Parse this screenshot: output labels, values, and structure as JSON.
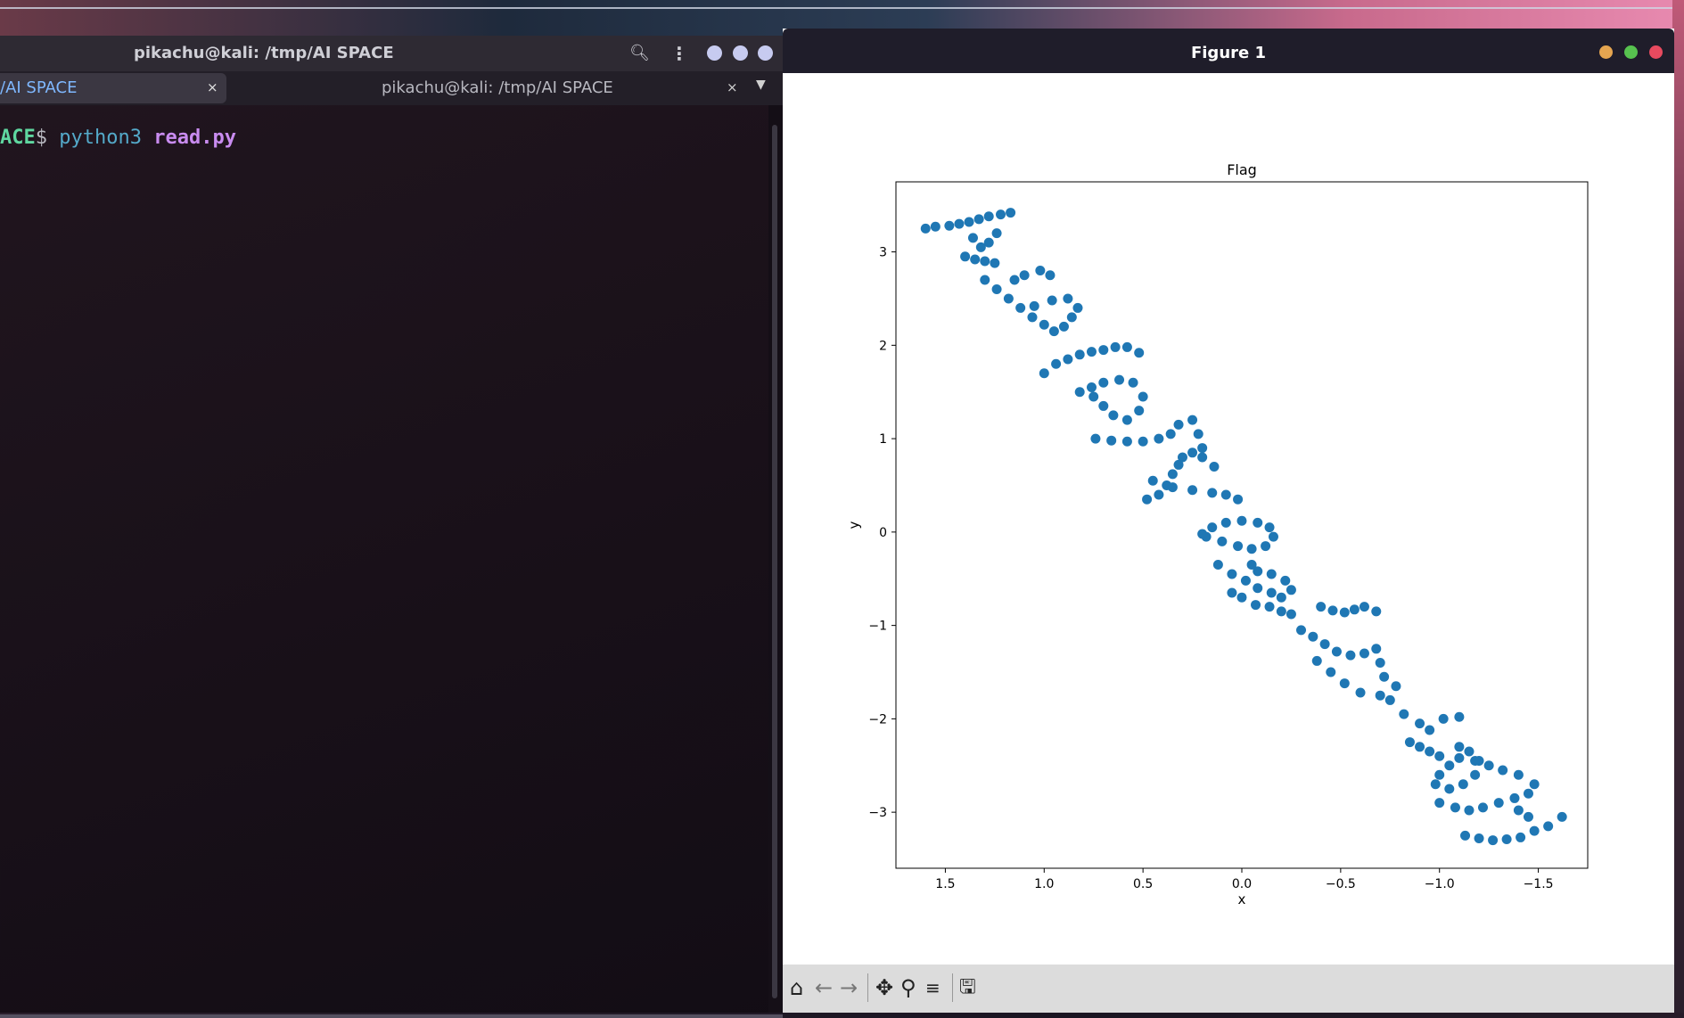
{
  "terminal": {
    "window_title": "pikachu@kali: /tmp/AI SPACE",
    "tabs": [
      {
        "label": "/AI SPACE",
        "close": "×"
      },
      {
        "label": "pikachu@kali: /tmp/AI SPACE",
        "close": "×"
      }
    ],
    "prompt": {
      "dir": "ACE",
      "dollar": "$ ",
      "command": "python3 ",
      "argument": "read.py"
    },
    "dot_color": "#c7cbf0"
  },
  "figure": {
    "window_title": "Figure 1",
    "dot_colors": [
      "#e5a550",
      "#57c24f",
      "#e84a5f"
    ],
    "toolbar": [
      "home-icon",
      "back-icon",
      "forward-icon",
      "pan-icon",
      "zoom-icon",
      "configure-icon",
      "save-icon"
    ]
  },
  "chart_data": {
    "type": "scatter",
    "title": "Flag",
    "xlabel": "x",
    "ylabel": "y",
    "xlim": [
      1.75,
      -1.75
    ],
    "ylim": [
      3.75,
      -3.6
    ],
    "xticks": [
      1.5,
      1.0,
      0.5,
      0.0,
      -0.5,
      -1.0,
      -1.5
    ],
    "xtick_labels": [
      "1.5",
      "1.0",
      "0.5",
      "0.0",
      "−0.5",
      "−1.0",
      "−1.5"
    ],
    "yticks": [
      -3,
      -2,
      -1,
      0,
      1,
      2,
      3
    ],
    "ytick_labels": [
      "−3",
      "−2",
      "−1",
      "0",
      "1",
      "2",
      "3"
    ],
    "color": "#1f77b4",
    "grid": false,
    "series": [
      {
        "values": [
          [
            1.6,
            3.25
          ],
          [
            1.55,
            3.27
          ],
          [
            1.48,
            3.28
          ],
          [
            1.43,
            3.3
          ],
          [
            1.38,
            3.32
          ],
          [
            1.33,
            3.35
          ],
          [
            1.28,
            3.38
          ],
          [
            1.22,
            3.4
          ],
          [
            1.17,
            3.42
          ],
          [
            1.4,
            2.95
          ],
          [
            1.35,
            2.92
          ],
          [
            1.3,
            2.9
          ],
          [
            1.25,
            2.88
          ],
          [
            1.32,
            3.05
          ],
          [
            1.36,
            3.15
          ],
          [
            1.28,
            3.1
          ],
          [
            1.24,
            3.2
          ],
          [
            1.3,
            2.7
          ],
          [
            1.24,
            2.6
          ],
          [
            1.18,
            2.5
          ],
          [
            1.12,
            2.4
          ],
          [
            1.06,
            2.3
          ],
          [
            1.0,
            2.22
          ],
          [
            0.95,
            2.15
          ],
          [
            0.9,
            2.2
          ],
          [
            0.86,
            2.3
          ],
          [
            0.83,
            2.4
          ],
          [
            0.88,
            2.5
          ],
          [
            0.96,
            2.48
          ],
          [
            1.05,
            2.42
          ],
          [
            1.15,
            2.7
          ],
          [
            1.1,
            2.75
          ],
          [
            1.02,
            2.8
          ],
          [
            0.97,
            2.75
          ],
          [
            1.0,
            1.7
          ],
          [
            0.94,
            1.8
          ],
          [
            0.88,
            1.85
          ],
          [
            0.82,
            1.9
          ],
          [
            0.76,
            1.93
          ],
          [
            0.7,
            1.95
          ],
          [
            0.64,
            1.98
          ],
          [
            0.58,
            1.98
          ],
          [
            0.52,
            1.92
          ],
          [
            0.82,
            1.5
          ],
          [
            0.75,
            1.45
          ],
          [
            0.7,
            1.35
          ],
          [
            0.65,
            1.25
          ],
          [
            0.58,
            1.2
          ],
          [
            0.52,
            1.3
          ],
          [
            0.5,
            1.45
          ],
          [
            0.55,
            1.6
          ],
          [
            0.62,
            1.63
          ],
          [
            0.7,
            1.6
          ],
          [
            0.76,
            1.55
          ],
          [
            0.74,
            1.0
          ],
          [
            0.66,
            0.98
          ],
          [
            0.58,
            0.97
          ],
          [
            0.5,
            0.97
          ],
          [
            0.42,
            1.0
          ],
          [
            0.36,
            1.05
          ],
          [
            0.32,
            1.15
          ],
          [
            0.25,
            1.2
          ],
          [
            0.22,
            1.05
          ],
          [
            0.2,
            0.9
          ],
          [
            0.48,
            0.35
          ],
          [
            0.42,
            0.4
          ],
          [
            0.38,
            0.5
          ],
          [
            0.35,
            0.62
          ],
          [
            0.32,
            0.72
          ],
          [
            0.3,
            0.8
          ],
          [
            0.25,
            0.85
          ],
          [
            0.2,
            0.8
          ],
          [
            0.14,
            0.7
          ],
          [
            0.45,
            0.55
          ],
          [
            0.35,
            0.48
          ],
          [
            0.25,
            0.45
          ],
          [
            0.15,
            0.42
          ],
          [
            0.08,
            0.4
          ],
          [
            0.02,
            0.35
          ],
          [
            0.18,
            -0.05
          ],
          [
            0.1,
            -0.1
          ],
          [
            0.02,
            -0.15
          ],
          [
            -0.05,
            -0.18
          ],
          [
            -0.12,
            -0.15
          ],
          [
            -0.16,
            -0.05
          ],
          [
            -0.14,
            0.05
          ],
          [
            -0.08,
            0.1
          ],
          [
            0.0,
            0.12
          ],
          [
            0.08,
            0.1
          ],
          [
            0.15,
            0.05
          ],
          [
            0.2,
            -0.02
          ],
          [
            0.12,
            -0.35
          ],
          [
            0.05,
            -0.45
          ],
          [
            -0.02,
            -0.52
          ],
          [
            -0.08,
            -0.6
          ],
          [
            -0.15,
            -0.65
          ],
          [
            -0.2,
            -0.7
          ],
          [
            -0.25,
            -0.62
          ],
          [
            -0.22,
            -0.52
          ],
          [
            -0.15,
            -0.45
          ],
          [
            -0.08,
            -0.42
          ],
          [
            -0.05,
            -0.35
          ],
          [
            -0.3,
            -1.05
          ],
          [
            -0.36,
            -1.12
          ],
          [
            -0.42,
            -1.2
          ],
          [
            -0.48,
            -1.28
          ],
          [
            -0.55,
            -1.32
          ],
          [
            -0.62,
            -1.3
          ],
          [
            -0.68,
            -1.25
          ],
          [
            -0.7,
            -1.4
          ],
          [
            -0.72,
            -1.55
          ],
          [
            -0.78,
            -1.65
          ],
          [
            -0.7,
            -1.75
          ],
          [
            -0.6,
            -1.72
          ],
          [
            -0.52,
            -1.62
          ],
          [
            -0.45,
            -1.5
          ],
          [
            -0.38,
            -1.38
          ],
          [
            -0.4,
            -0.8
          ],
          [
            -0.46,
            -0.84
          ],
          [
            -0.52,
            -0.86
          ],
          [
            -0.57,
            -0.83
          ],
          [
            -0.62,
            -0.8
          ],
          [
            -0.68,
            -0.85
          ],
          [
            -0.25,
            -0.88
          ],
          [
            -0.2,
            -0.85
          ],
          [
            -0.14,
            -0.8
          ],
          [
            -0.07,
            -0.78
          ],
          [
            0.0,
            -0.7
          ],
          [
            0.05,
            -0.65
          ],
          [
            -0.75,
            -1.8
          ],
          [
            -0.82,
            -1.95
          ],
          [
            -0.9,
            -2.05
          ],
          [
            -0.95,
            -2.12
          ],
          [
            -1.02,
            -2.0
          ],
          [
            -1.1,
            -1.98
          ],
          [
            -0.85,
            -2.25
          ],
          [
            -0.9,
            -2.3
          ],
          [
            -0.95,
            -2.35
          ],
          [
            -1.0,
            -2.4
          ],
          [
            -1.05,
            -2.5
          ],
          [
            -1.0,
            -2.6
          ],
          [
            -0.98,
            -2.7
          ],
          [
            -1.05,
            -2.75
          ],
          [
            -1.12,
            -2.7
          ],
          [
            -1.18,
            -2.6
          ],
          [
            -1.2,
            -2.45
          ],
          [
            -1.15,
            -2.35
          ],
          [
            -1.1,
            -2.3
          ],
          [
            -1.0,
            -2.9
          ],
          [
            -1.08,
            -2.95
          ],
          [
            -1.15,
            -2.98
          ],
          [
            -1.22,
            -2.95
          ],
          [
            -1.3,
            -2.9
          ],
          [
            -1.38,
            -2.85
          ],
          [
            -1.45,
            -2.8
          ],
          [
            -1.48,
            -2.7
          ],
          [
            -1.4,
            -2.6
          ],
          [
            -1.32,
            -2.55
          ],
          [
            -1.25,
            -2.5
          ],
          [
            -1.18,
            -2.45
          ],
          [
            -1.1,
            -2.42
          ],
          [
            -1.13,
            -3.25
          ],
          [
            -1.2,
            -3.28
          ],
          [
            -1.27,
            -3.3
          ],
          [
            -1.34,
            -3.29
          ],
          [
            -1.41,
            -3.27
          ],
          [
            -1.48,
            -3.2
          ],
          [
            -1.55,
            -3.15
          ],
          [
            -1.62,
            -3.05
          ],
          [
            -1.45,
            -3.05
          ],
          [
            -1.4,
            -2.98
          ]
        ]
      }
    ]
  }
}
